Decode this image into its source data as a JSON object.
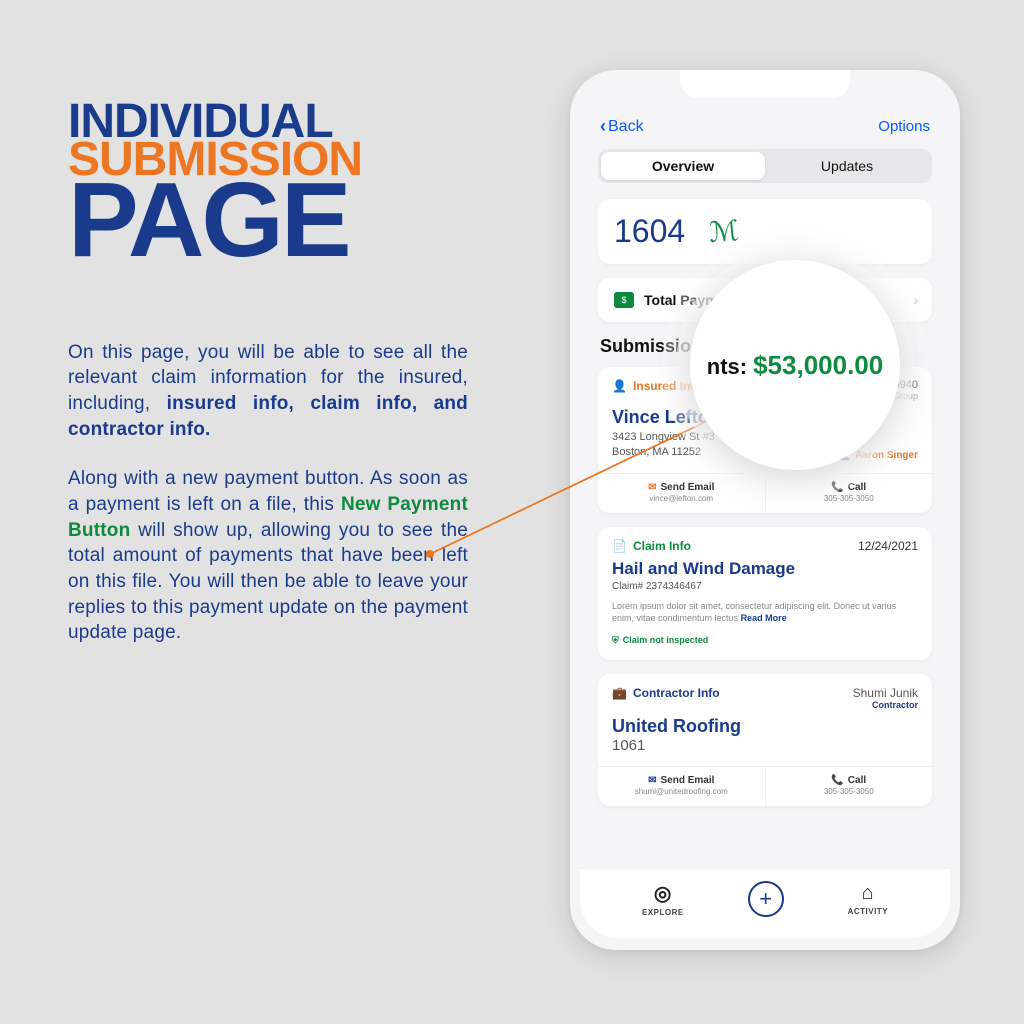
{
  "colors": {
    "navy": "#1a3b8c",
    "orange": "#ed7622",
    "green": "#0e8a3f"
  },
  "headline": {
    "line1": "INDIVIDUAL",
    "line2": "SUBMISSION",
    "line3": "PAGE"
  },
  "desc1_part1": "On this page, you will be able to see all the relevant claim information for the insured, including, ",
  "desc1_bold": "insured info, claim info, and contractor info.",
  "desc2_part1": "Along with a new payment button. As soon as a payment is left on a file, this ",
  "desc2_highlight": "New Payment Button",
  "desc2_part2": " will show up, allowing you to see the total amount of payments that have been left on this file. You will then be able to leave your replies to this payment update on the payment update page.",
  "phone": {
    "back": "Back",
    "options": "Options",
    "tabs": {
      "overview": "Overview",
      "updates": "Updates"
    },
    "signature_number": "1604",
    "total_payments_label": "Total Payments:",
    "section_title": "Submission Info",
    "insured": {
      "label": "Insured Info",
      "policy_id": "TX-018-00940",
      "company": "United Insurance Group",
      "name": "Vince Lefton",
      "addr1": "3423 Longview St #3",
      "addr2": "Boston, MA 11252",
      "assignee": "Aaron Singer",
      "email_label": "Send Email",
      "email_value": "vince@lefton.com",
      "call_label": "Call",
      "call_value": "305-305-3050"
    },
    "claim": {
      "label": "Claim Info",
      "date": "12/24/2021",
      "title": "Hail and Wind Damage",
      "number": "Claim# 2374346467",
      "lorem_part": "Lorem ipsum dolor sit amet, consectetur adipiscing elit. Donec ut varius enim, vitae condimentum lectus ",
      "readmore": "Read More",
      "chip": "Claim not inspected"
    },
    "contractor": {
      "label": "Contractor Info",
      "person": "Shumi Junik",
      "role": "Contractor",
      "company": "United Roofing",
      "number": "1061",
      "email_label": "Send Email",
      "email_value": "shumi@unitedroofing.com",
      "call_label": "Call",
      "call_value": "305-305-3050"
    },
    "nav": {
      "explore": "EXPLORE",
      "activity": "ACTIVITY"
    }
  },
  "magnifier": {
    "partial_label": "nts:",
    "amount": "$53,000.00"
  }
}
